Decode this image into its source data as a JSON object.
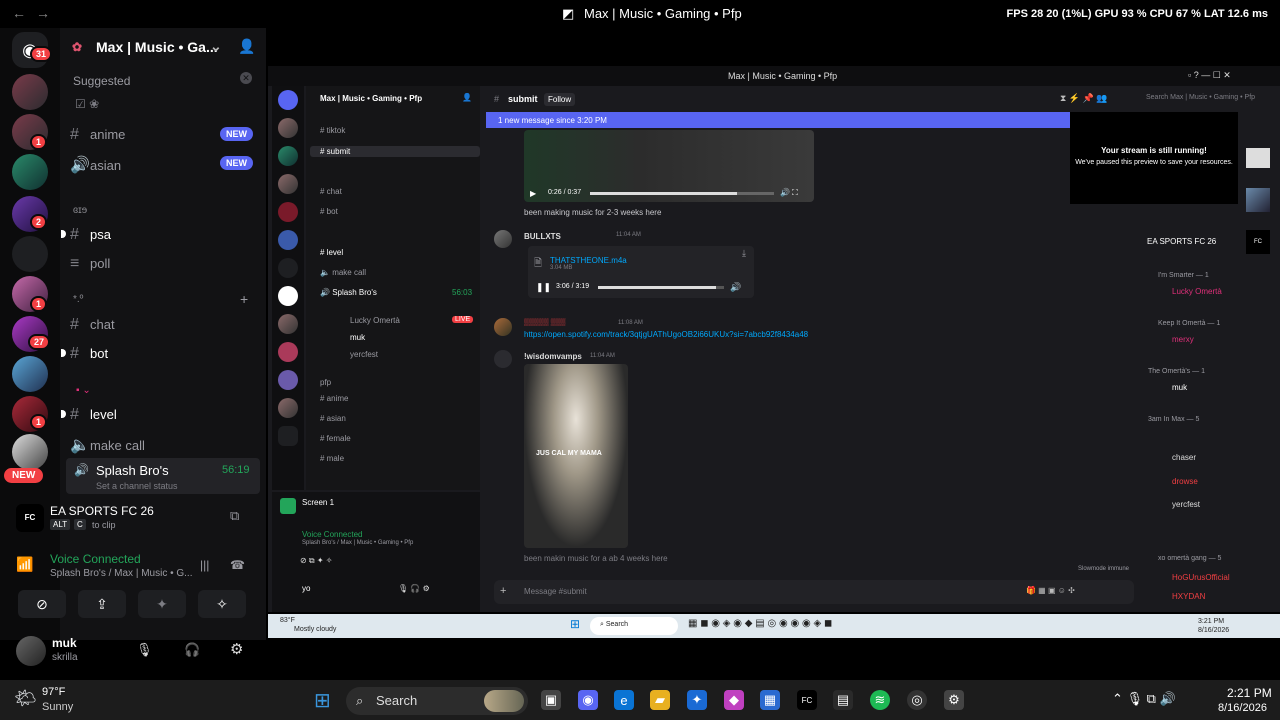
{
  "window": {
    "title": "Max | Music • Gaming • Pfp",
    "stats": "FPS  28   20 (1%L)   GPU 93 %   CPU 67 %   LAT 12.6 ms"
  },
  "rail": {
    "home_badge": "31",
    "badges": [
      "1",
      "1",
      "2",
      "1",
      "27",
      "1"
    ],
    "new_label": "NEW"
  },
  "server": {
    "name": "Max | Music • Ga...",
    "suggested_label": "Suggested",
    "channels": [
      {
        "name": "anime",
        "type": "hash",
        "new": "NEW"
      },
      {
        "name": "asian",
        "type": "hash",
        "new": "NEW"
      },
      {
        "name": "psa",
        "type": "hash"
      },
      {
        "name": "poll",
        "type": "hash"
      },
      {
        "name": "chat",
        "type": "hash"
      },
      {
        "name": "bot",
        "type": "hash"
      },
      {
        "name": "level",
        "type": "hash"
      },
      {
        "name": "make call",
        "type": "voice"
      }
    ],
    "category1": "ɞɪɘ",
    "category2": "*.º",
    "voice_channel": {
      "name": "Splash Bro's",
      "time": "56:19",
      "status": "Set a channel status"
    }
  },
  "activity": {
    "game": "EA SPORTS FC 26",
    "hint_key1": "ALT",
    "hint_key2": "C",
    "hint": "to clip"
  },
  "voice": {
    "status": "Voice Connected",
    "location": "Splash Bro's / Max | Music • G..."
  },
  "user": {
    "name": "muk",
    "status": "skrilla"
  },
  "inner": {
    "title": "Max | Music • Gaming • Pfp",
    "server_name": "Max | Music • Gaming • Pfp",
    "channel": "submit",
    "follow": "Follow",
    "search_placeholder": "Search Max | Music • Gaming • Pfp",
    "new_messages": "1 new message since 3:20 PM",
    "channels": [
      "tiktok",
      "submit",
      "chat",
      "bot",
      "level",
      "make call"
    ],
    "voice_ch": "Splash Bro's",
    "voice_ch_time": "56:03",
    "voice_members": [
      "Lucky Omertà",
      "muk",
      "yercfest"
    ],
    "live": "LIVE",
    "pfp_label": "pfp",
    "pfp_channels": [
      "anime",
      "asian",
      "female",
      "male"
    ],
    "screen_label": "Screen 1",
    "voice_status": "Voice Connected",
    "voice_loc": "Splash Bro's / Max | Music • Gaming • Pfp",
    "user_name": "yo",
    "messages": [
      {
        "author": "",
        "text": "been making music for 2-3 weeks here",
        "time": "0:26 / 0:37"
      },
      {
        "author": "BULLXTS",
        "time": "11:04 AM",
        "file": "THATSTHEONE.m4a",
        "size": "3.04 MB",
        "progress": "3:06 / 3:19"
      },
      {
        "author": "",
        "time": "11:08 AM",
        "link": "https://open.spotify.com/track/3qtjgUAThUgoOB2i66UKUx?si=7abcb92f8434a48"
      },
      {
        "author": "!wisdomvamps",
        "time": "11:04 AM",
        "caption": "JUS CAL MY MAMA",
        "text": "been makin music for a ab 4 weeks here"
      }
    ],
    "stream_title": "Your stream is still running!",
    "stream_text": "We've paused this preview to save your resources.",
    "input_placeholder": "Message #submit",
    "slowmode": "Slowmode immune",
    "members": [
      {
        "section": "I'm Smarter — 1",
        "names": [
          "Lucky Omertà"
        ]
      },
      {
        "section": "Keep It Omertà — 1",
        "names": [
          "merxy"
        ]
      },
      {
        "section": "The Omertà's — 1",
        "names": [
          "muk"
        ]
      },
      {
        "section": "3am In Max — 5",
        "names": [
          "chaser",
          "drowse",
          "yercfest"
        ]
      },
      {
        "section": "xo omertà gang — 5",
        "names": [
          "HoGUrusOfficial",
          "HXYDAN"
        ]
      }
    ],
    "activity_game": "EA SPORTS FC 26",
    "weather": "83°F",
    "weather_text": "Mostly cloudy",
    "clock": "3:21 PM",
    "date": "8/16/2026",
    "search": "Search"
  },
  "taskbar": {
    "weather_temp": "97°F",
    "weather_text": "Sunny",
    "search": "Search",
    "time": "2:21 PM",
    "date": "8/16/2026"
  }
}
